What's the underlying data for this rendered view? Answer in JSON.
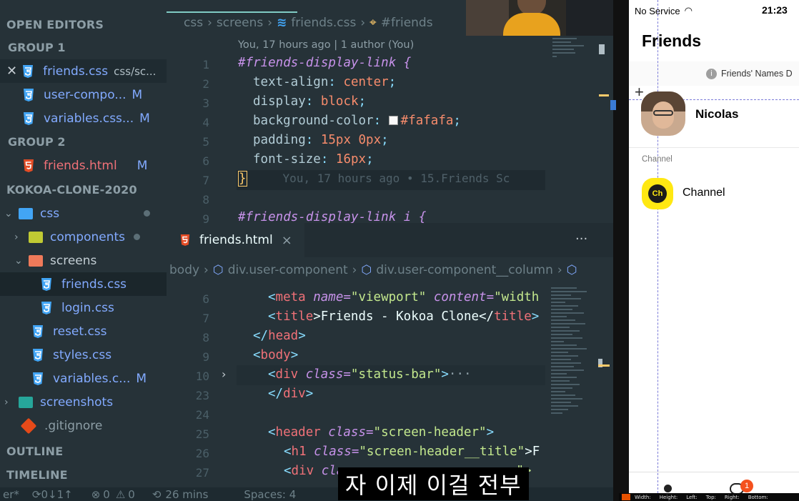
{
  "sidebar": {
    "open_editors": "OPEN EDITORS",
    "group1": "GROUP 1",
    "group1_items": [
      {
        "name": "friends.css",
        "path": "css/sc..."
      },
      {
        "name": "user-compo...",
        "mod": "M"
      },
      {
        "name": "variables.css...",
        "mod": "M"
      }
    ],
    "group2": "GROUP 2",
    "group2_items": [
      {
        "name": "friends.html",
        "mod": "M"
      }
    ],
    "project": "KOKOA-CLONE-2020",
    "tree": {
      "css": "css",
      "components": "components",
      "screens": "screens",
      "friends_css": "friends.css",
      "login_css": "login.css",
      "reset_css": "reset.css",
      "styles_css": "styles.css",
      "variables_css": "variables.c...",
      "variables_mod": "M",
      "screenshots": "screenshots",
      "gitignore": ".gitignore"
    },
    "outline": "OUTLINE",
    "timeline": "TIMELINE"
  },
  "editor_top": {
    "breadcrumb": [
      "css",
      "screens",
      "friends.css",
      "#friends"
    ],
    "blame_header": "You, 17 hours ago | 1 author (You)",
    "lines": [
      {
        "n": "1",
        "text": "#friends-display-link {"
      },
      {
        "n": "2",
        "prop": "text-align",
        "val": "center"
      },
      {
        "n": "3",
        "prop": "display",
        "val": "block"
      },
      {
        "n": "4",
        "prop": "background-color",
        "val": "#fafafa"
      },
      {
        "n": "5",
        "prop": "padding",
        "val": "15px 0px"
      },
      {
        "n": "6",
        "prop": "font-size",
        "val": "16px"
      },
      {
        "n": "7",
        "text": "}",
        "blame": "You, 17 hours ago • 15.Friends Sc"
      },
      {
        "n": "8",
        "text": ""
      },
      {
        "n": "9",
        "text": "#friends-display-link i {"
      }
    ]
  },
  "editor_bot": {
    "tab_label": "friends.html",
    "tab_close": "×",
    "more": "···",
    "breadcrumb": [
      "body",
      "div.user-component",
      "div.user-component__column"
    ],
    "lines": [
      {
        "n": "6",
        "a": "<",
        "b": "meta",
        "c": " name=",
        "d": "\"viewport\"",
        "e": " content=",
        "f": "\"width"
      },
      {
        "n": "7",
        "a": "<",
        "b": "title",
        "c": ">Friends - Kokoa Clone</",
        "d": "title",
        "e": ">"
      },
      {
        "n": "8",
        "a": "</",
        "b": "head",
        "c": ">"
      },
      {
        "n": "9",
        "a": "<",
        "b": "body",
        "c": ">"
      },
      {
        "n": "10",
        "a": "<",
        "b": "div",
        "c": " class=",
        "d": "\"status-bar\"",
        "e": ">",
        "f": "···"
      },
      {
        "n": "23",
        "a": "</",
        "b": "div",
        "c": ">"
      },
      {
        "n": "24"
      },
      {
        "n": "25",
        "a": "<",
        "b": "header",
        "c": " class=",
        "d": "\"screen-header\"",
        "e": ">"
      },
      {
        "n": "26",
        "a": "<",
        "b": "h1",
        "c": " class=",
        "d": "\"screen-header__title\"",
        "e": ">F"
      },
      {
        "n": "27",
        "a": "<",
        "b": "div",
        "c": " cla",
        "e": "ns\">"
      }
    ]
  },
  "statusbar": {
    "branch": "er*",
    "sync": "0↓1↑",
    "errors": "0",
    "warnings": "0",
    "time": "26 mins",
    "spaces": "Spaces: 4"
  },
  "phone": {
    "carrier": "No Service",
    "clock": "21:23",
    "title": "Friends",
    "names_banner": "Friends' Names D",
    "user_name": "Nicolas",
    "section_channel": "Channel",
    "channel_name": "Channel",
    "channel_logo": "Ch",
    "badge": "1",
    "inspector": [
      "Width:",
      "Height:",
      "Left:",
      "Top:",
      "Right:",
      "Bottom:"
    ]
  },
  "subtitle": "자 이제 이걸 전부",
  "colors": {
    "bg": "#263238",
    "accent_css": "#42a5f5",
    "accent_html": "#e44d26",
    "channel_yellow": "#ffe812",
    "badge": "#f4511e"
  }
}
